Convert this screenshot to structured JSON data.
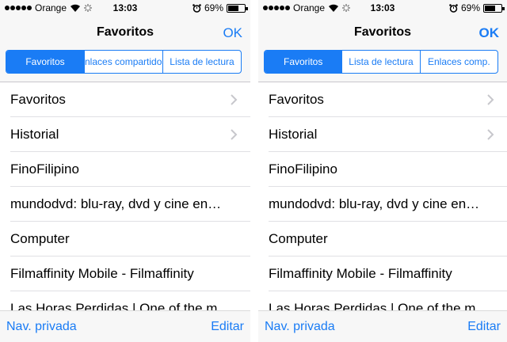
{
  "left": {
    "status": {
      "carrier": "Orange",
      "time": "13:03",
      "battery": "69%",
      "battery_level": 0.69
    },
    "nav": {
      "title": "Favoritos",
      "ok": "OK"
    },
    "segments": [
      "Favoritos",
      "nlaces compartidos",
      "Lista de lectura"
    ],
    "rows": [
      {
        "label": "Favoritos",
        "chevron": true
      },
      {
        "label": "Historial",
        "chevron": true
      },
      {
        "label": "FinoFilipino",
        "chevron": false
      },
      {
        "label": "mundodvd: blu-ray, dvd y cine en…",
        "chevron": false
      },
      {
        "label": "Computer",
        "chevron": false
      },
      {
        "label": "Filmaffinity Mobile - Filmaffinity",
        "chevron": false
      },
      {
        "label": "Las Horas Perdidas | One of the m",
        "chevron": false
      }
    ],
    "toolbar": {
      "left": "Nav. privada",
      "right": "Editar"
    }
  },
  "right": {
    "status": {
      "carrier": "Orange",
      "time": "13:03",
      "battery": "69%",
      "battery_level": 0.69
    },
    "nav": {
      "title": "Favoritos",
      "ok": "OK"
    },
    "segments": [
      "Favoritos",
      "Lista de lectura",
      "Enlaces comp."
    ],
    "rows": [
      {
        "label": "Favoritos",
        "chevron": true
      },
      {
        "label": "Historial",
        "chevron": true
      },
      {
        "label": "FinoFilipino",
        "chevron": false
      },
      {
        "label": "mundodvd: blu-ray, dvd y cine en…",
        "chevron": false
      },
      {
        "label": "Computer",
        "chevron": false
      },
      {
        "label": "Filmaffinity Mobile - Filmaffinity",
        "chevron": false
      },
      {
        "label": "Las Horas Perdidas | One of the m",
        "chevron": false
      }
    ],
    "toolbar": {
      "left": "Nav. privada",
      "right": "Editar"
    }
  },
  "colors": {
    "accent": "#1a7cf5",
    "separator": "#e0e0e4",
    "bar_background": "#f7f7f7"
  },
  "icons": [
    "signal-dots-icon",
    "wifi-icon",
    "activity-spinner-icon",
    "alarm-icon",
    "battery-icon",
    "chevron-right-icon"
  ]
}
